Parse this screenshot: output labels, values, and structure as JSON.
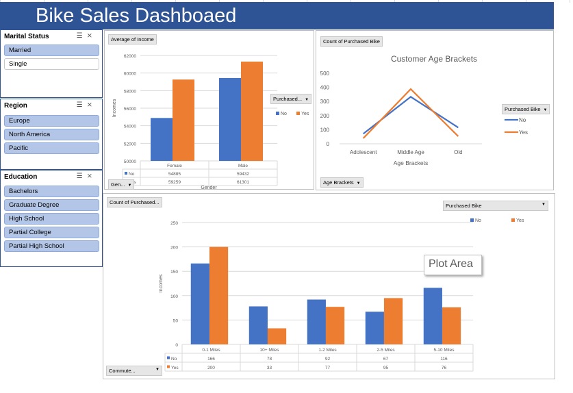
{
  "dashboard": {
    "title": "Bike Sales Dashboaed"
  },
  "slicers": {
    "marital": {
      "title": "Marital Status",
      "items": [
        {
          "label": "Married",
          "selected": true
        },
        {
          "label": "Single",
          "selected": false
        }
      ]
    },
    "region": {
      "title": "Region",
      "items": [
        {
          "label": "Europe",
          "selected": true
        },
        {
          "label": "North America",
          "selected": true
        },
        {
          "label": "Pacific",
          "selected": true
        }
      ]
    },
    "education": {
      "title": "Education",
      "items": [
        {
          "label": "Bachelors",
          "selected": true
        },
        {
          "label": "Graduate Degree",
          "selected": true
        },
        {
          "label": "High School",
          "selected": true
        },
        {
          "label": "Partial College",
          "selected": true
        },
        {
          "label": "Partial High School",
          "selected": true
        }
      ]
    }
  },
  "field_buttons": {
    "income_value": "Average of Income",
    "income_legend": "Purchased...",
    "income_axis": "Gen...",
    "age_value": "Count of Purchased Bike",
    "age_legend": "Purchased Bike",
    "age_axis": "Age Brackets",
    "commute_value": "Count of Purchased...",
    "commute_legend": "Purchased Bike",
    "commute_axis": "Commute..."
  },
  "tooltip": {
    "text": "Plot Area"
  },
  "colors": {
    "header": "#2f5496",
    "no": "#4472c4",
    "yes": "#ed7d31",
    "slicer_selected": "#b4c6e7"
  },
  "chart_data": [
    {
      "type": "bar",
      "categories": [
        "Female",
        "Male"
      ],
      "series": [
        {
          "name": "No",
          "values": [
            54885,
            59432
          ]
        },
        {
          "name": "Yes",
          "values": [
            59259,
            61301
          ]
        }
      ],
      "display": {
        "No": [
          "54885",
          "59432"
        ],
        "Yes": [
          "59259",
          "61301"
        ]
      },
      "title": "",
      "xlabel": "Gender",
      "ylabel": "Incomes",
      "ylim": [
        50000,
        62000
      ],
      "yticks": [
        "50000",
        "52000",
        "54000",
        "56000",
        "58000",
        "60000",
        "62000"
      ],
      "grid": true,
      "legend": "right",
      "data_table": true
    },
    {
      "type": "line",
      "categories": [
        "Adolescent",
        "Middle Age",
        "Old"
      ],
      "series": [
        {
          "name": "No",
          "values": [
            71,
            333,
            115
          ]
        },
        {
          "name": "Yes",
          "values": [
            39,
            388,
            53
          ]
        }
      ],
      "title": "Customer Age Brackets",
      "xlabel": "Age Brackets",
      "ylabel": "",
      "ylim": [
        0,
        500
      ],
      "yticks": [
        "0",
        "100",
        "200",
        "300",
        "400",
        "500"
      ],
      "grid": false,
      "legend": "right"
    },
    {
      "type": "bar",
      "categories": [
        "0-1 Miles",
        "10+ Miles",
        "1-2 Miles",
        "2-5 Miles",
        "5-10 Miles"
      ],
      "series": [
        {
          "name": "No",
          "values": [
            166,
            78,
            92,
            67,
            116
          ]
        },
        {
          "name": "Yes",
          "values": [
            200,
            33,
            77,
            95,
            76
          ]
        }
      ],
      "display": {
        "No": [
          "166",
          "78",
          "92",
          "67",
          "116"
        ],
        "Yes": [
          "200",
          "33",
          "77",
          "95",
          "76"
        ]
      },
      "title": "",
      "xlabel": "",
      "ylabel": "Incomes",
      "ylim": [
        0,
        250
      ],
      "yticks": [
        "0",
        "50",
        "100",
        "150",
        "200",
        "250"
      ],
      "grid": true,
      "legend": "top-right",
      "data_table": true
    }
  ]
}
